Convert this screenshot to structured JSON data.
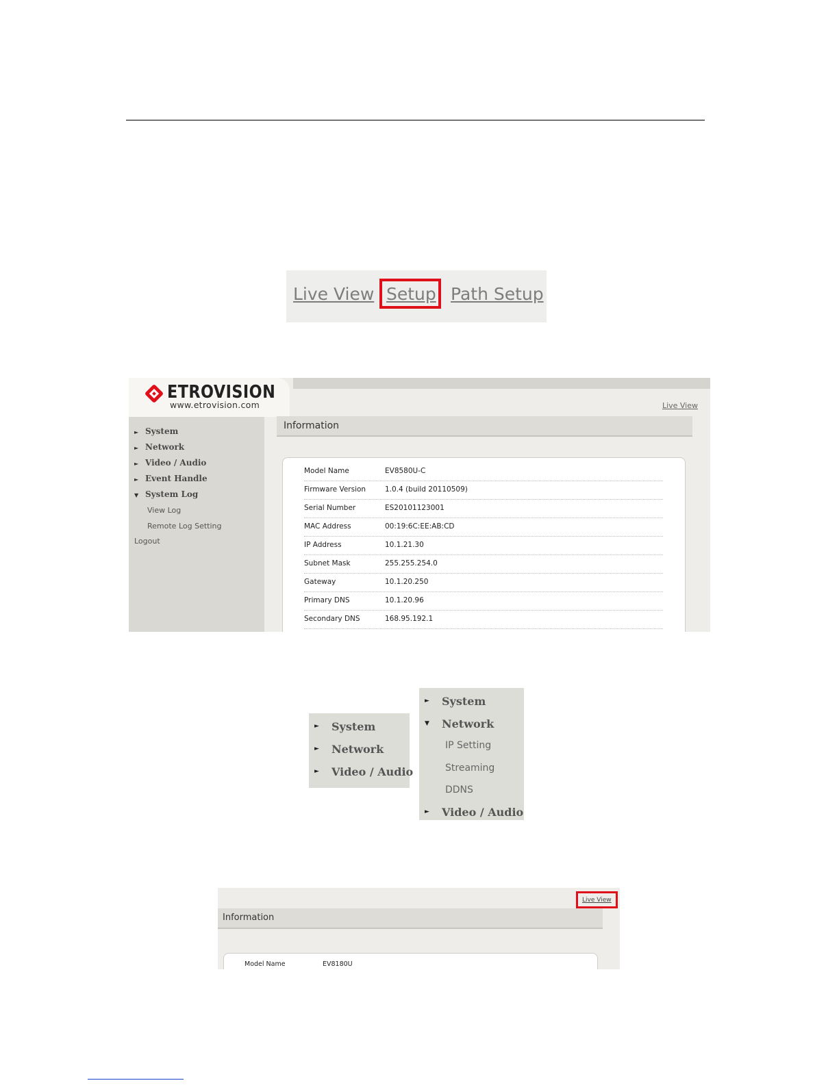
{
  "nav": {
    "live_view": "Live View",
    "setup": "Setup",
    "path_setup": "Path Setup"
  },
  "brand": {
    "name": "ETROVISION",
    "url": "www.etrovision.com",
    "accent_color": "#e0101a"
  },
  "sidebar": {
    "items": [
      {
        "label": "System",
        "expanded": false
      },
      {
        "label": "Network",
        "expanded": false
      },
      {
        "label": "Video / Audio",
        "expanded": false
      },
      {
        "label": "Event Handle",
        "expanded": false
      },
      {
        "label": "System Log",
        "expanded": true
      }
    ],
    "system_log_children": [
      "View Log",
      "Remote Log Setting"
    ],
    "logout": "Logout"
  },
  "main": {
    "live_view_link": "Live View",
    "section_title": "Information",
    "rows": [
      {
        "label": "Model Name",
        "value": "EV8580U-C"
      },
      {
        "label": "Firmware Version",
        "value": "1.0.4  (build 20110509)"
      },
      {
        "label": "Serial Number",
        "value": "ES20101123001"
      },
      {
        "label": "MAC Address",
        "value": "00:19:6C:EE:AB:CD"
      },
      {
        "label": "IP Address",
        "value": "10.1.21.30"
      },
      {
        "label": "Subnet Mask",
        "value": "255.255.254.0"
      },
      {
        "label": "Gateway",
        "value": "10.1.20.250"
      },
      {
        "label": "Primary DNS",
        "value": "10.1.20.96"
      },
      {
        "label": "Secondary DNS",
        "value": "168.95.192.1"
      }
    ]
  },
  "menu_collapsed": {
    "items": [
      "System",
      "Network",
      "Video / Audio"
    ]
  },
  "menu_expanded": {
    "items": [
      "System",
      "Network",
      "Video / Audio"
    ],
    "network_children": [
      "IP Setting",
      "Streaming",
      "DDNS"
    ]
  },
  "second_screen": {
    "live_view_link": "Live View",
    "section_title": "Information",
    "row": {
      "label": "Model Name",
      "value": "EV8180U"
    }
  }
}
